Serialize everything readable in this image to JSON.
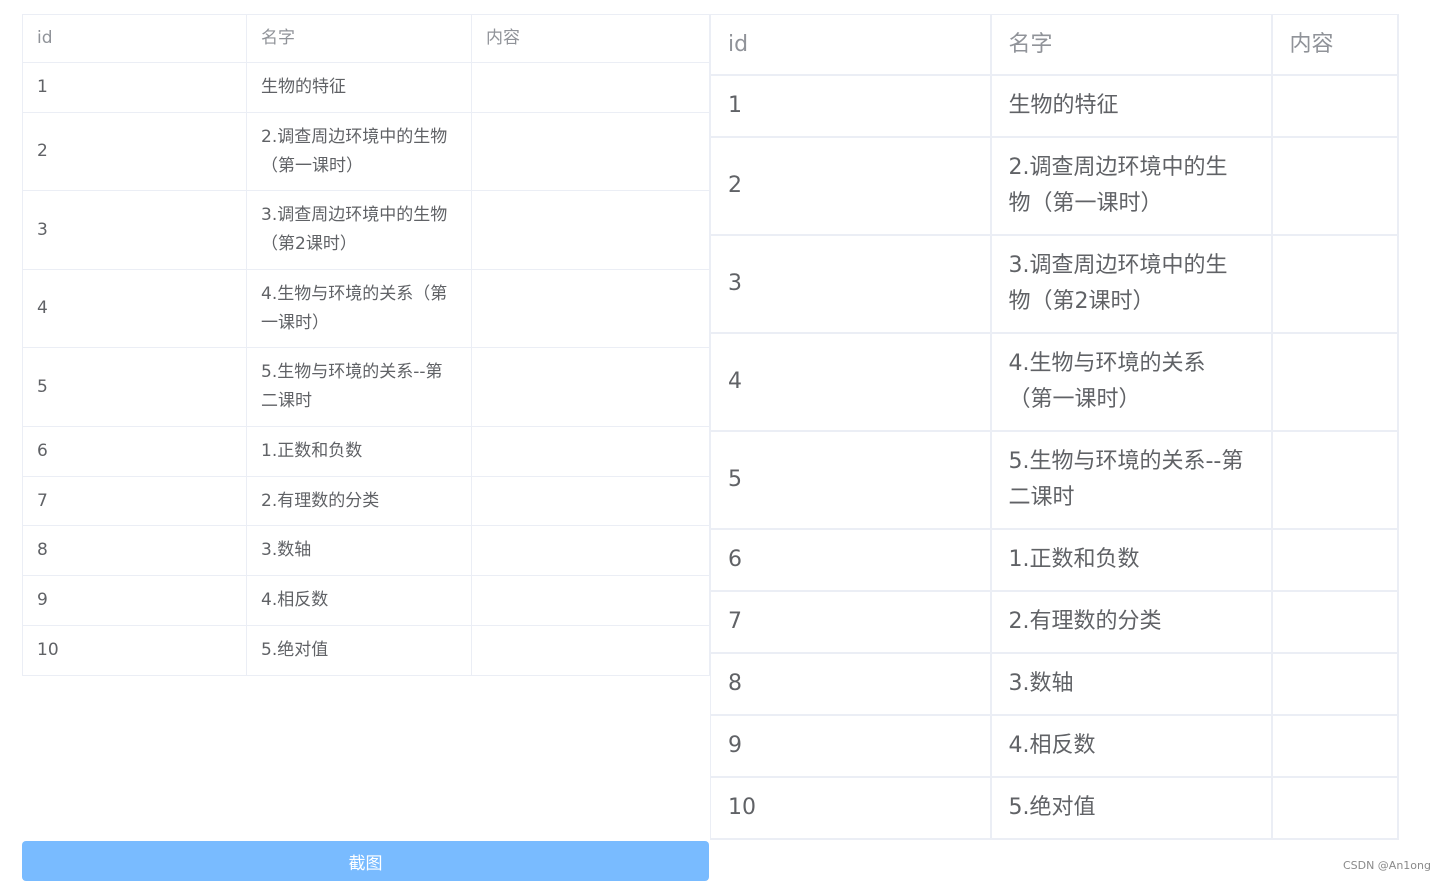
{
  "table": {
    "headers": [
      "id",
      "名字",
      "内容"
    ],
    "rows": [
      {
        "id": "1",
        "name": "生物的特征",
        "content": ""
      },
      {
        "id": "2",
        "name": "2.调查周边环境中的生物（第一课时）",
        "content": ""
      },
      {
        "id": "3",
        "name": "3.调查周边环境中的生物（第2课时）",
        "content": ""
      },
      {
        "id": "4",
        "name": "4.生物与环境的关系（第一课时）",
        "content": ""
      },
      {
        "id": "5",
        "name": "5.生物与环境的关系--第二课时",
        "content": ""
      },
      {
        "id": "6",
        "name": "1.正数和负数",
        "content": ""
      },
      {
        "id": "7",
        "name": "2.有理数的分类",
        "content": ""
      },
      {
        "id": "8",
        "name": "3.数轴",
        "content": ""
      },
      {
        "id": "9",
        "name": "4.相反数",
        "content": ""
      },
      {
        "id": "10",
        "name": "5.绝对值",
        "content": ""
      }
    ]
  },
  "capture_button": {
    "label": "截图",
    "color": "#79bbff"
  },
  "watermark": "CSDN @An1ong",
  "colors": {
    "border": "#ebeef5",
    "header_text": "#909399",
    "body_text": "#606266"
  }
}
